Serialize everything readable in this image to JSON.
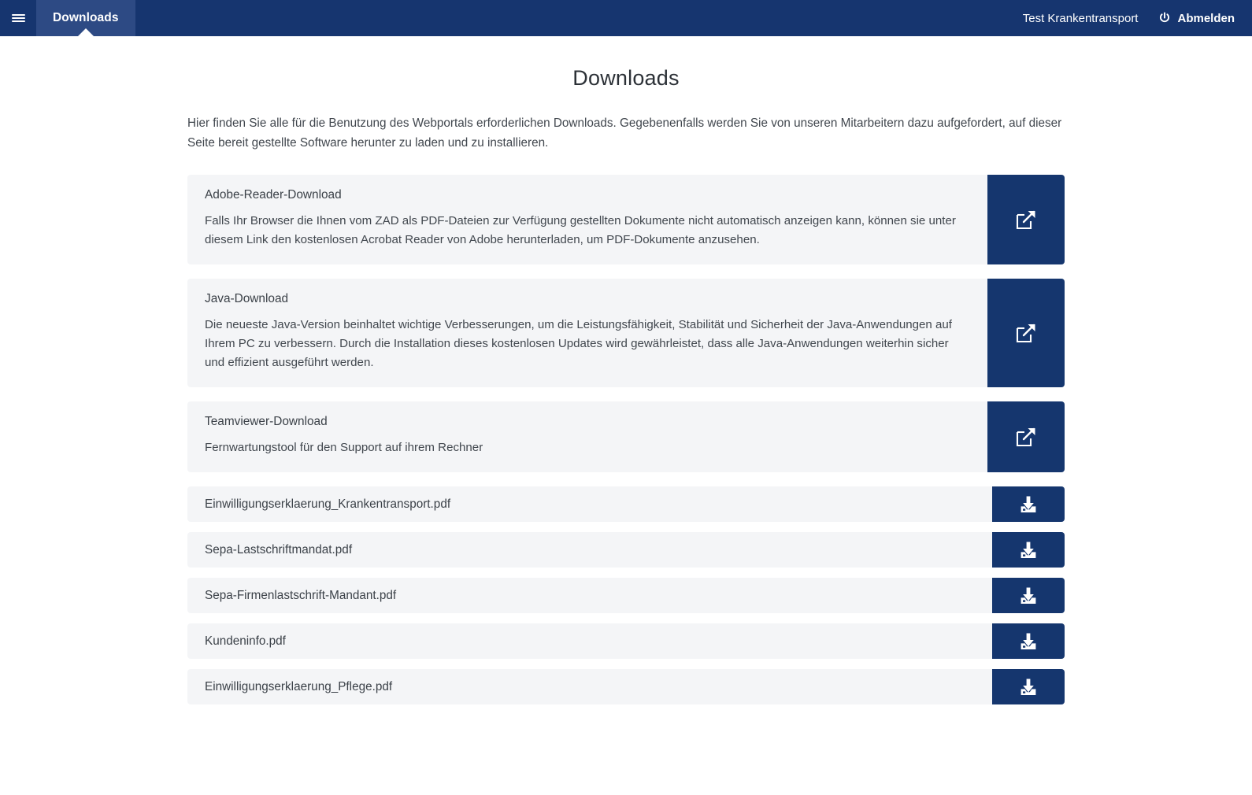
{
  "topbar": {
    "menu_icon": "hamburger-icon",
    "active_tab": "Downloads",
    "account_name": "Test Krankentransport",
    "logout_label": "Abmelden",
    "logout_icon": "power-icon",
    "background_color": "#16356f",
    "active_tab_color": "#2d4a84"
  },
  "page": {
    "title": "Downloads",
    "intro": "Hier finden Sie alle für die Benutzung des Webportals erforderlichen Downloads. Gegebenenfalls werden Sie von unseren Mitarbeitern dazu aufgefordert, auf dieser Seite bereit gestellte Software herunter zu laden und zu installieren."
  },
  "software_downloads": [
    {
      "title": "Adobe-Reader-Download",
      "description": "Falls Ihr Browser die Ihnen vom ZAD als PDF-Dateien zur Verfügung gestellten Dokumente nicht automatisch anzeigen kann, können sie unter diesem Link den kostenlosen Acrobat Reader von Adobe herunterladen, um PDF-Dokumente anzusehen.",
      "action_icon": "external-link-icon"
    },
    {
      "title": "Java-Download",
      "description": "Die neueste Java-Version beinhaltet wichtige Verbesserungen, um die Leistungsfähigkeit, Stabilität und Sicherheit der Java-Anwendungen auf Ihrem PC zu verbessern. Durch die Installation dieses kostenlosen Updates wird gewährleistet, dass alle Java-Anwendungen weiterhin sicher und effizient ausgeführt werden.",
      "action_icon": "external-link-icon"
    },
    {
      "title": "Teamviewer-Download",
      "description": "Fernwartungstool für den Support auf ihrem Rechner",
      "action_icon": "external-link-icon"
    }
  ],
  "file_downloads": [
    {
      "name": "Einwilligungserklaerung_Krankentransport.pdf",
      "action_icon": "download-icon"
    },
    {
      "name": "Sepa-Lastschriftmandat.pdf",
      "action_icon": "download-icon"
    },
    {
      "name": "Sepa-Firmenlastschrift-Mandant.pdf",
      "action_icon": "download-icon"
    },
    {
      "name": "Kundeninfo.pdf",
      "action_icon": "download-icon"
    },
    {
      "name": "Einwilligungserklaerung_Pflege.pdf",
      "action_icon": "download-icon"
    }
  ],
  "colors": {
    "brand_dark_blue": "#16356f",
    "button_blue": "#15366e",
    "card_grey": "#f4f5f7",
    "text_dark": "#3b4148"
  }
}
